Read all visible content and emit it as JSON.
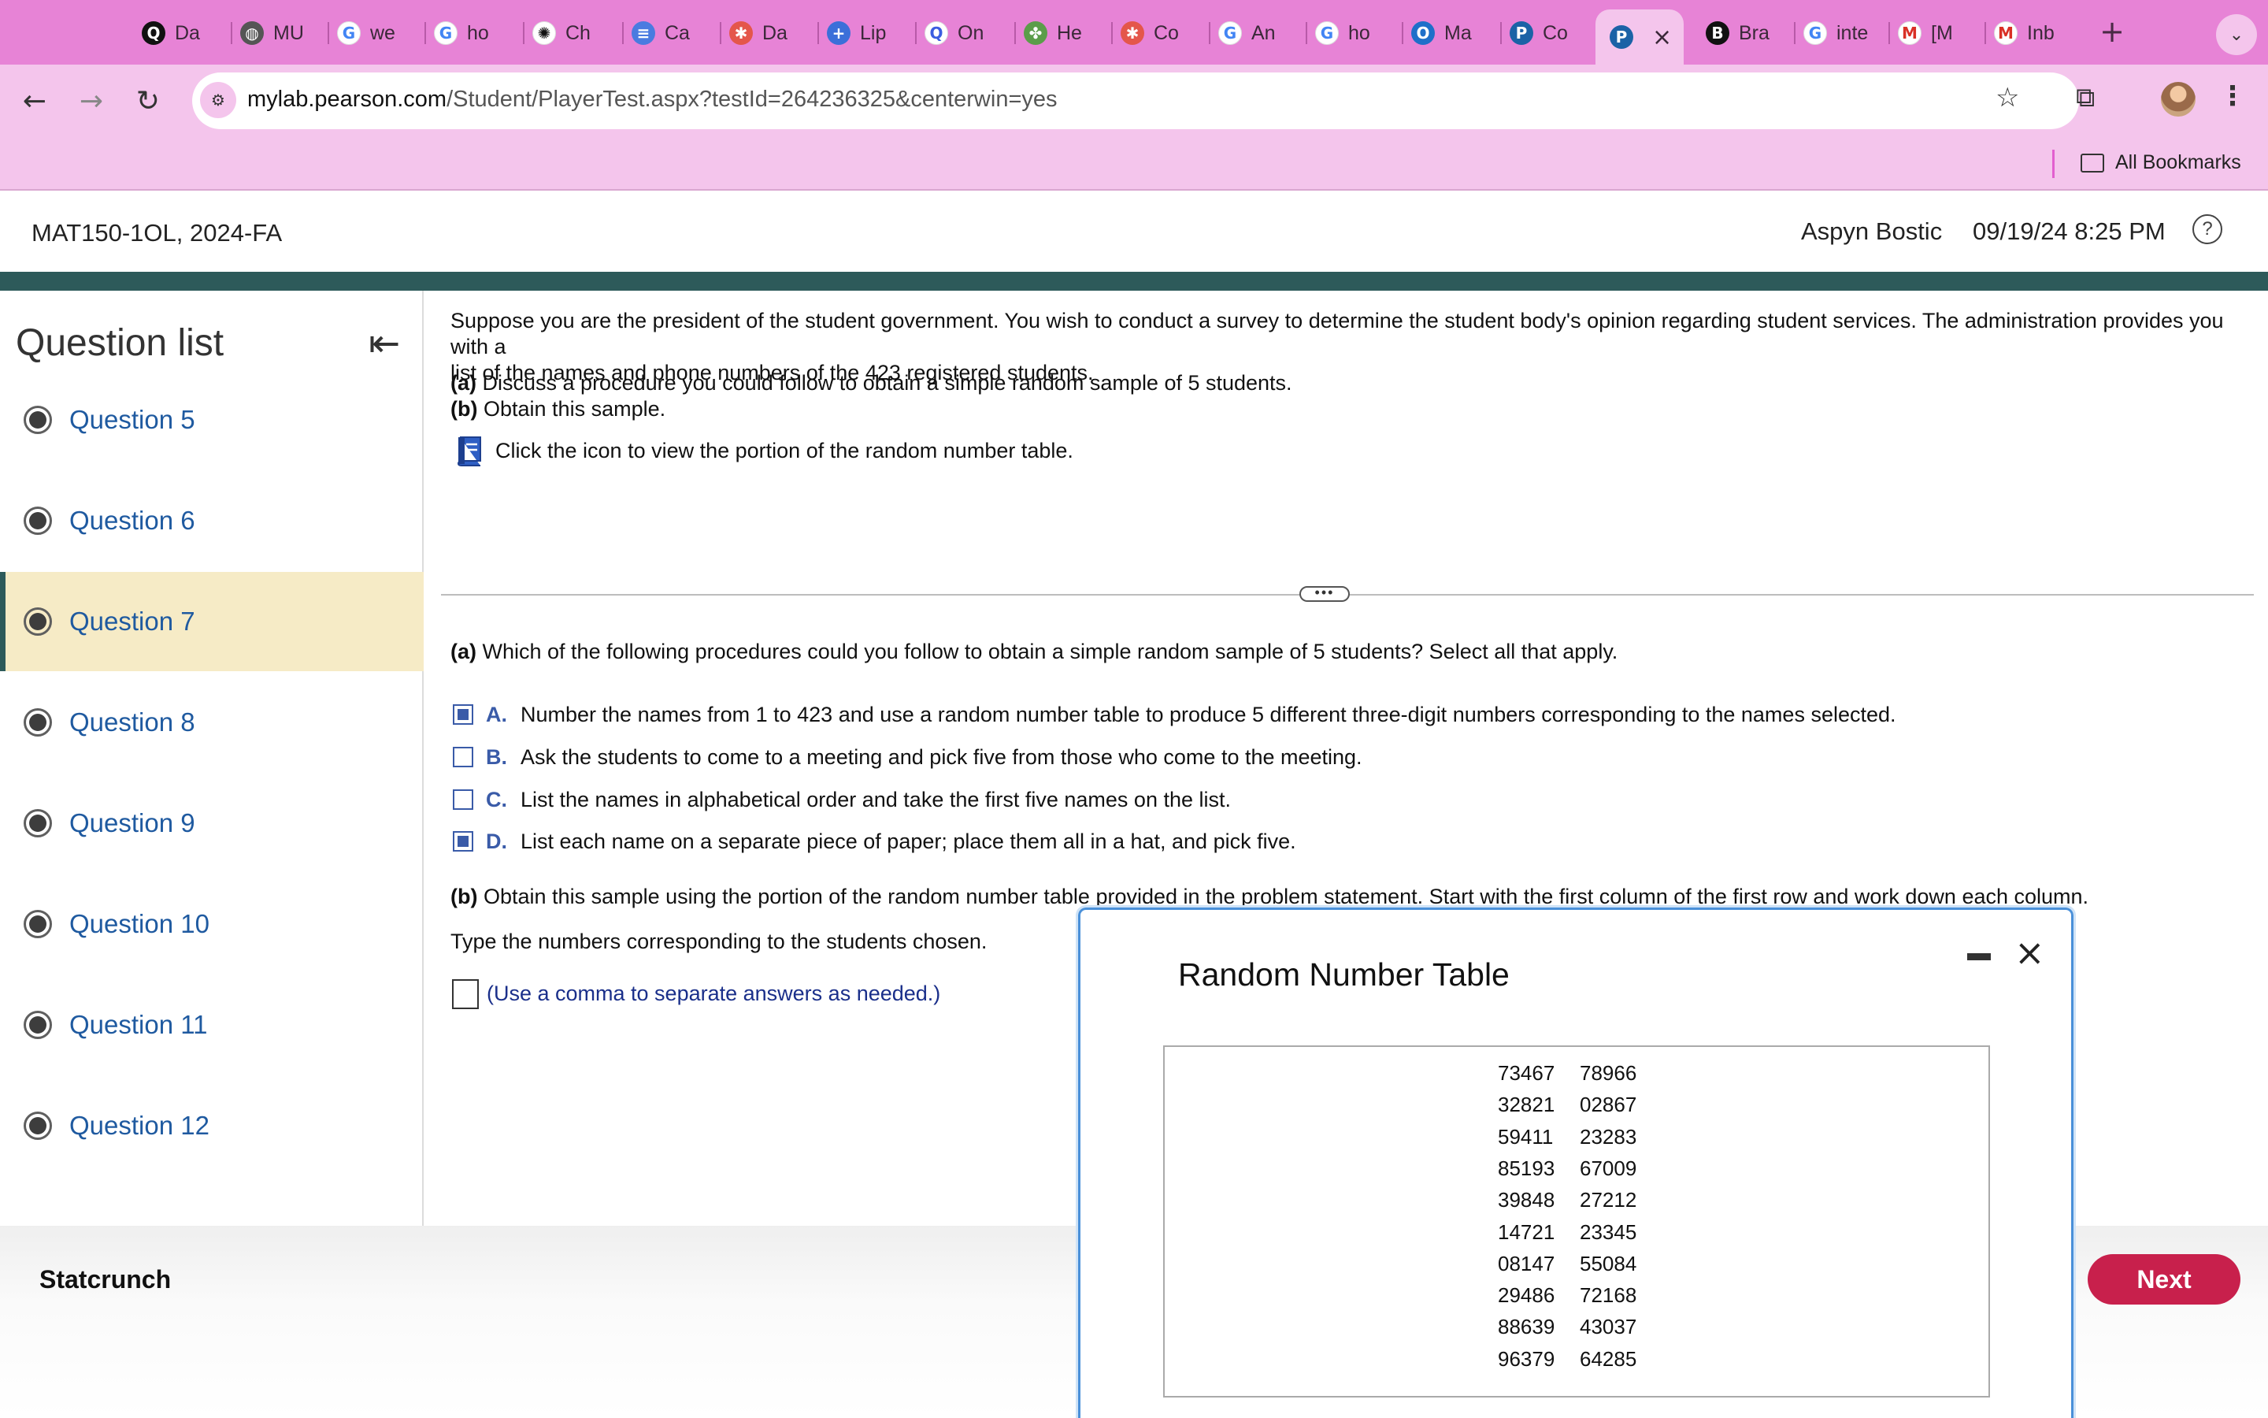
{
  "browser": {
    "tabs": [
      {
        "label": "Da",
        "icon": "q-logo"
      },
      {
        "label": "MU",
        "icon": "globe-icon"
      },
      {
        "label": "we",
        "icon": "google-icon"
      },
      {
        "label": "ho",
        "icon": "google-icon"
      },
      {
        "label": "Ch",
        "icon": "chatgpt-icon"
      },
      {
        "label": "Ca",
        "icon": "docs-icon"
      },
      {
        "label": "Da",
        "icon": "dots-icon"
      },
      {
        "label": "Lip",
        "icon": "plus-icon"
      },
      {
        "label": "On",
        "icon": "search-q-icon"
      },
      {
        "label": "He",
        "icon": "puzzle-icon"
      },
      {
        "label": "Co",
        "icon": "dots-icon"
      },
      {
        "label": "An",
        "icon": "google-icon"
      },
      {
        "label": "ho",
        "icon": "google-icon"
      },
      {
        "label": "Ma",
        "icon": "outlook-icon"
      },
      {
        "label": "Co",
        "icon": "pearson-icon"
      },
      {
        "label": "",
        "icon": "pearson-icon",
        "active": true
      },
      {
        "label": "Bra",
        "icon": "b-icon"
      },
      {
        "label": "inte",
        "icon": "google-icon"
      },
      {
        "label": "[M",
        "icon": "gmail-icon"
      },
      {
        "label": "Inb",
        "icon": "gmail-icon"
      }
    ],
    "close_tab": "×",
    "new_tab": "+",
    "url_host": "mylab.pearson.com",
    "url_path": "/Student/PlayerTest.aspx?testId=264236325&centerwin=yes",
    "bookmarks_label": "All Bookmarks"
  },
  "header": {
    "course": "MAT150-1OL, 2024-FA",
    "student": "Aspyn Bostic",
    "datetime": "09/19/24 8:25 PM",
    "help": "?"
  },
  "sidebar": {
    "title": "Question list",
    "items": [
      {
        "label": "Question 5"
      },
      {
        "label": "Question 6"
      },
      {
        "label": "Question 7",
        "current": true
      },
      {
        "label": "Question 8"
      },
      {
        "label": "Question 9"
      },
      {
        "label": "Question 10"
      },
      {
        "label": "Question 11"
      },
      {
        "label": "Question 12"
      }
    ]
  },
  "question": {
    "prompt_line1": "Suppose you are the president of the student government. You wish to conduct a survey to determine the student body's opinion regarding student services. The administration provides you with a",
    "prompt_line2": "list of the names and phone numbers of the 423 registered students.",
    "part_a_tag": "(a)",
    "part_a_text": "Discuss a procedure you could follow to obtain a simple random sample of 5 students.",
    "part_b_tag": "(b)",
    "part_b_text": "Obtain this sample.",
    "icon_hint": "Click the icon to view the portion of the random number table.",
    "grip": "•••",
    "a_question_tag": "(a)",
    "a_question_text": "Which of the following procedures could you follow to obtain a simple random sample of 5 students? Select all that apply.",
    "choices": [
      {
        "letter": "A.",
        "text": "Number the names from 1 to 423 and use a random number table to produce 5 different three-digit numbers corresponding to the names selected.",
        "checked": true
      },
      {
        "letter": "B.",
        "text": "Ask the students to come to a meeting and pick five from those who come to the meeting.",
        "checked": false
      },
      {
        "letter": "C.",
        "text": "List the names in alphabetical order and take the first five names on the list.",
        "checked": false
      },
      {
        "letter": "D.",
        "text": "List each name on a separate piece of paper; place them all in a hat, and pick five.",
        "checked": true
      }
    ],
    "b_question_tag": "(b)",
    "b_question_text": "Obtain this sample using the portion of the random number table provided in the problem statement. Start with the first column of the first row and work down each column.",
    "type_instruction": "Type the numbers corresponding to the students chosen.",
    "answer_hint": "(Use a comma to separate answers as needed.)"
  },
  "popup": {
    "title": "Random Number Table",
    "close": "×",
    "rows": [
      [
        "73467",
        "78966"
      ],
      [
        "32821",
        "02867"
      ],
      [
        "59411",
        "23283"
      ],
      [
        "85193",
        "67009"
      ],
      [
        "39848",
        "27212"
      ],
      [
        "14721",
        "23345"
      ],
      [
        "08147",
        "55084"
      ],
      [
        "29486",
        "72168"
      ],
      [
        "88639",
        "43037"
      ],
      [
        "96379",
        "64285"
      ]
    ]
  },
  "footer": {
    "statcrunch": "Statcrunch",
    "next": "Next"
  },
  "colors": {
    "tabbar": "#e783d6",
    "toolbar": "#f4c5ec",
    "header_band": "#2d5a5a",
    "current_question_bg": "#f6ebc6",
    "link_blue": "#1f5aa0",
    "choice_blue": "#3a5ba8",
    "next_button": "#c8204c",
    "popup_border": "#4a90d9"
  }
}
